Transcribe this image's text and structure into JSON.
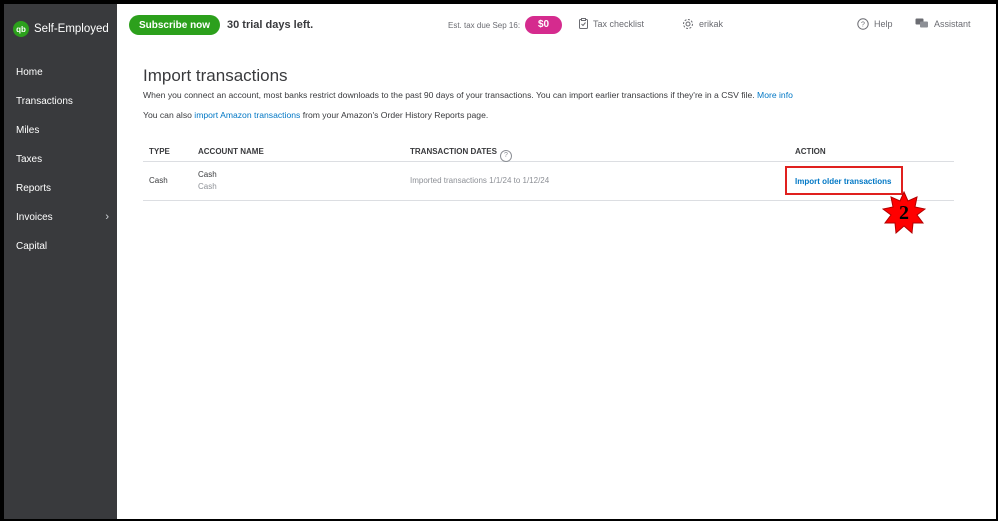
{
  "sidebar": {
    "brand": "Self-Employed",
    "logo_text": "qb",
    "items": [
      {
        "label": "Home"
      },
      {
        "label": "Transactions"
      },
      {
        "label": "Miles"
      },
      {
        "label": "Taxes"
      },
      {
        "label": "Reports"
      },
      {
        "label": "Invoices",
        "has_chevron": true
      },
      {
        "label": "Capital"
      }
    ]
  },
  "topbar": {
    "subscribe_label": "Subscribe now",
    "trial_text": "30 trial days left.",
    "est_tax_label": "Est. tax due Sep 16:",
    "est_tax_value": "$0",
    "tax_checklist_label": "Tax checklist",
    "user_name": "erikak",
    "help_label": "Help",
    "assistant_label": "Assistant"
  },
  "page": {
    "title": "Import transactions",
    "description_prefix": "When you connect an account, most banks restrict downloads to the past 90 days of your transactions. You can import earlier transactions if they're in a CSV file.",
    "more_info_link": "More info",
    "amazon_prefix": "You can also",
    "amazon_link": "import Amazon transactions",
    "amazon_suffix": "from your Amazon's Order History Reports page."
  },
  "table": {
    "headers": {
      "type": "TYPE",
      "account_name": "ACCOUNT NAME",
      "transaction_dates": "TRANSACTION DATES",
      "action": "ACTION"
    },
    "rows": [
      {
        "type": "Cash",
        "account_name": "Cash",
        "account_sub": "Cash",
        "transaction_dates": "Imported transactions 1/1/24 to 1/12/24",
        "action_label": "Import older transactions"
      }
    ]
  },
  "annotation": {
    "step_number": "2"
  },
  "colors": {
    "sidebar_bg": "#393a3d",
    "brand_green": "#2ca01c",
    "link_blue": "#0077c5",
    "tax_badge": "#d52b8e",
    "highlight_red": "#e0201e",
    "step_badge_fill": "#ff0000"
  }
}
